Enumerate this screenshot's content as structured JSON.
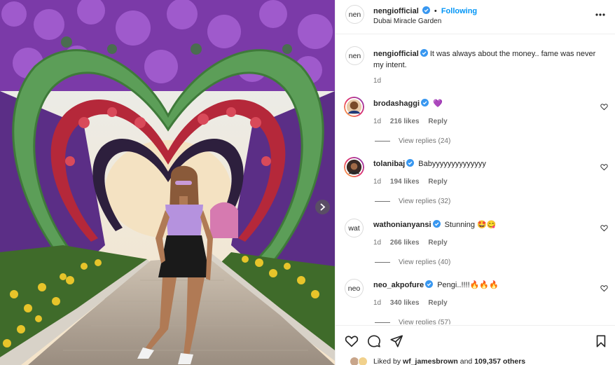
{
  "post": {
    "author": "nengiofficial",
    "follow_state": "Following",
    "separator": "•",
    "location": "Dubai Miracle Garden",
    "author_avatar_text": "nen"
  },
  "caption": {
    "avatar_text": "nen",
    "username": "nengiofficial",
    "text": "It was always about the money.. fame was never my intent.",
    "age": "1d"
  },
  "comments": [
    {
      "username": "brodashaggi",
      "text": "💜",
      "age": "1d",
      "likes": "216 likes",
      "reply": "Reply",
      "replies": "View replies (24)",
      "avatar_text": ""
    },
    {
      "username": "tolanibaj",
      "text": "Babyyyyyyyyyyyyyy",
      "age": "1d",
      "likes": "194 likes",
      "reply": "Reply",
      "replies": "View replies (32)",
      "avatar_text": ""
    },
    {
      "username": "wathonianyansi",
      "text": "Stunning 🤩😋",
      "age": "1d",
      "likes": "266 likes",
      "reply": "Reply",
      "replies": "View replies (40)",
      "avatar_text": "wat"
    },
    {
      "username": "neo_akpofure",
      "text": "Pengi..!!!!🔥🔥🔥",
      "age": "1d",
      "likes": "340 likes",
      "reply": "Reply",
      "replies": "View replies (57)",
      "avatar_text": "neo"
    }
  ],
  "likes_summary": {
    "prefix": "Liked by",
    "user": "wf_jamesbrown",
    "connector": "and",
    "count": "109,357 others"
  },
  "icons": {
    "more": "more-options-icon",
    "like": "heart-icon",
    "comment": "comment-icon",
    "share": "share-icon",
    "save": "bookmark-icon",
    "next": "chevron-right-icon",
    "verified": "verified-badge-icon"
  },
  "colors": {
    "link_blue": "#0095f6",
    "verified_blue": "#3897f0",
    "muted": "#737373",
    "border": "#efefef"
  }
}
